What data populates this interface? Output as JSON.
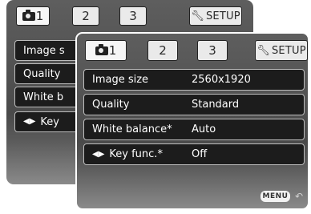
{
  "back_screen": {
    "tabs": [
      "1",
      "2",
      "3"
    ],
    "setup_label": "SETUP",
    "rows": [
      {
        "label": "Image s"
      },
      {
        "label": "Quality"
      },
      {
        "label": "White b"
      },
      {
        "label": "Key"
      }
    ]
  },
  "front_screen": {
    "tabs": [
      "1",
      "2",
      "3"
    ],
    "setup_label": "SETUP",
    "rows": [
      {
        "label": "Image size",
        "value": "2560x1920"
      },
      {
        "label": "Quality",
        "value": "Standard"
      },
      {
        "label": "White balance*",
        "value": "Auto"
      },
      {
        "label": "Key func.*",
        "value": "Off"
      }
    ],
    "menu_label": "MENU"
  },
  "icons": {
    "tab1": "camera-icon",
    "setup": "wrench-icon",
    "key_func": "left-right-arrows-icon",
    "return": "return-arrow-icon"
  },
  "colors": {
    "panel_bg": "#4a4a4a",
    "row_bg": "#1c1c1c",
    "row_border": "#bdbdbd",
    "tab_bg": "#eaeaea",
    "text": "#ffffff"
  }
}
